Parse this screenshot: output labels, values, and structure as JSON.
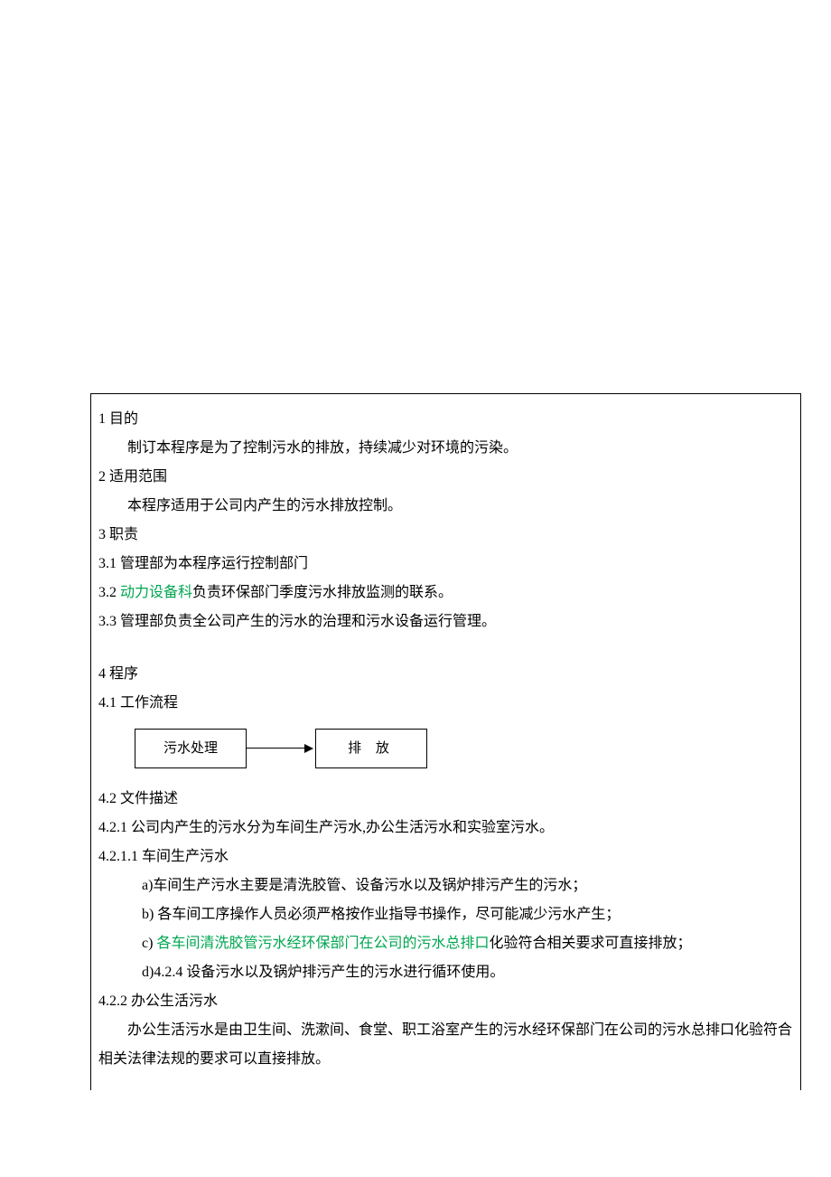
{
  "s1": {
    "h": "1 目的",
    "p": "制订本程序是为了控制污水的排放，持续减少对环境的污染。"
  },
  "s2": {
    "h": "2 适用范围",
    "p": "本程序适用于公司内产生的污水排放控制。"
  },
  "s3": {
    "h": "3 职责",
    "r1": "3.1 管理部为本程序运行控制部门",
    "r2a": "3.2 ",
    "r2b": "动力设备科",
    "r2c": "负责环保部门季度污水排放监测的联系。",
    "r3": "3.3 管理部负责全公司产生的污水的治理和污水设备运行管理。"
  },
  "s4": {
    "h": "4 程序",
    "h41": "4.1 工作流程",
    "flow": {
      "box1": "污水处理",
      "box2": "排  放"
    },
    "h42": "4.2 文件描述",
    "h421": "4.2.1 公司内产生的污水分为车间生产污水,办公生活污水和实验室污水。",
    "h4211": "4.2.1.1 车间生产污水",
    "a": "a)车间生产污水主要是清洗胶管、设备污水以及锅炉排污产生的污水；",
    "b": "b) 各车间工序操作人员必须严格按作业指导书操作，尽可能减少污水产生；",
    "c_a": "c) ",
    "c_b": "各车间清洗胶管污水经环保部门在公司的污水总排口",
    "c_c": "化验符合相关要求可直接排放；",
    "d": "d)4.2.4 设备污水以及锅炉排污产生的污水进行循环使用。",
    "h422": "4.2.2 办公生活污水",
    "p422": "办公生活污水是由卫生间、洗漱间、食堂、职工浴室产生的污水经环保部门在公司的污水总排口化验符合相关法律法规的要求可以直接排放。"
  }
}
